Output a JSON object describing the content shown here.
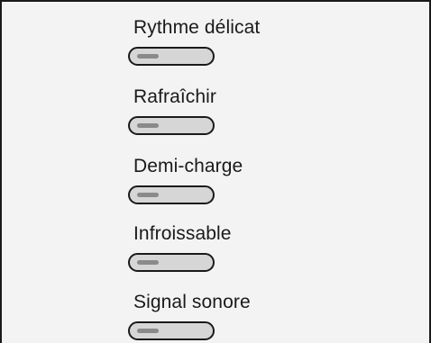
{
  "options": [
    {
      "label": "Rythme délicat"
    },
    {
      "label": "Rafraîchir"
    },
    {
      "label": "Demi-charge"
    },
    {
      "label": "Infroissable"
    },
    {
      "label": "Signal sonore"
    }
  ]
}
